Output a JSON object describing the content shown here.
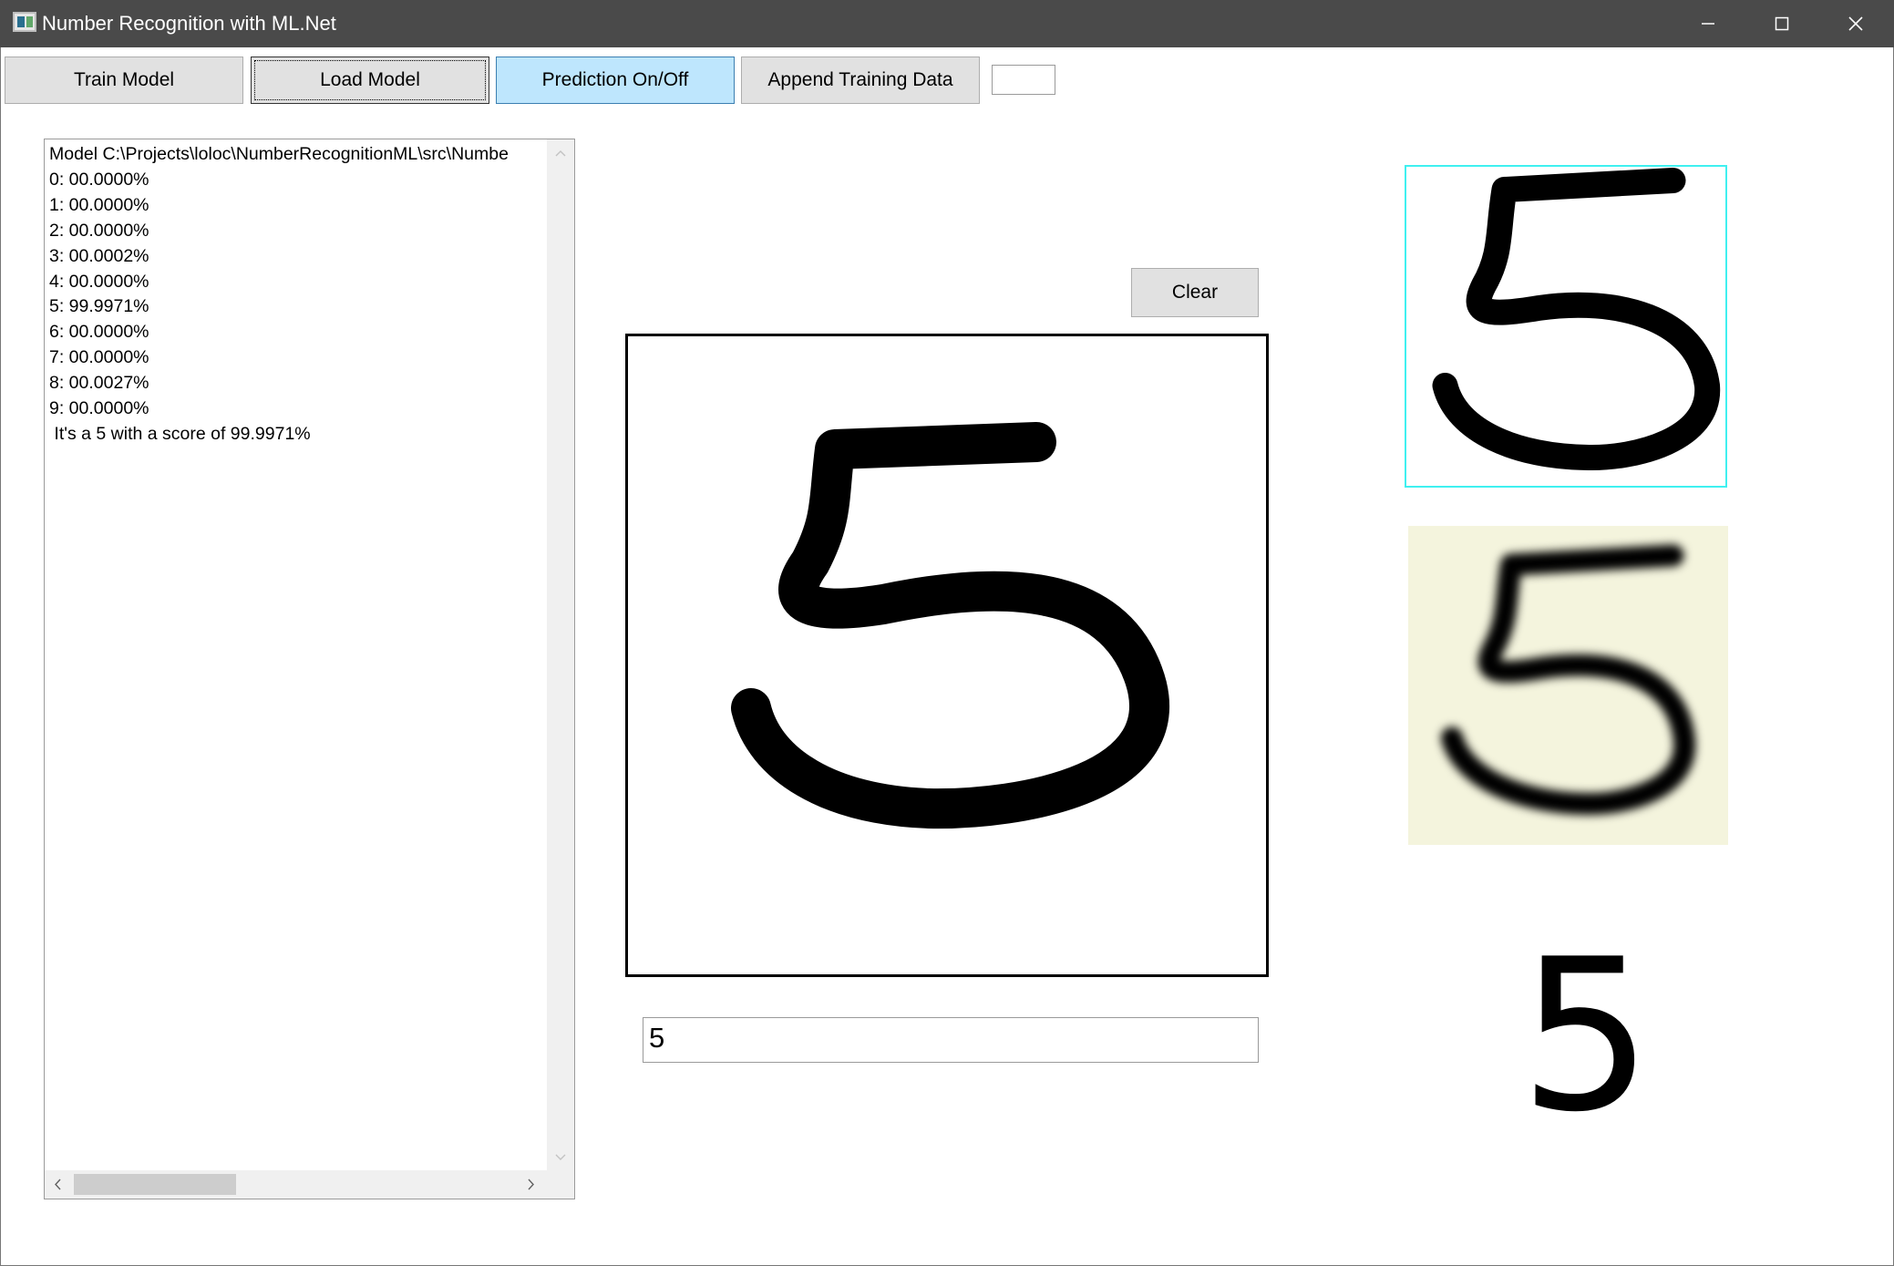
{
  "window": {
    "title": "Number Recognition with ML.Net"
  },
  "toolbar": {
    "train_label": "Train Model",
    "load_label": "Load Model",
    "prediction_label": "Prediction On/Off",
    "append_label": "Append Training Data",
    "small_field_value": ""
  },
  "log": {
    "lines": [
      "Model C:\\Projects\\loloc\\NumberRecognitionML\\src\\Numbe",
      "0: 00.0000%",
      "1: 00.0000%",
      "2: 00.0000%",
      "3: 00.0002%",
      "4: 00.0000%",
      "5: 99.9971%",
      "6: 00.0000%",
      "7: 00.0000%",
      "8: 00.0027%",
      "9: 00.0000%",
      " It's a 5 with a score of 99.9971%"
    ]
  },
  "canvas": {
    "clear_label": "Clear",
    "result_value": "5"
  },
  "preview": {
    "predicted_digit": "5"
  },
  "colors": {
    "titlebar": "#4a4a4a",
    "button_face": "#e1e1e1",
    "button_active": "#bee6fd",
    "button_active_border": "#3c7fb1",
    "crop_border": "#3ff0f0",
    "scaled_background": "#f4f4dd"
  },
  "icons": {
    "minimize": "minimize-icon",
    "maximize": "maximize-icon",
    "close": "close-icon",
    "scroll_up": "chevron-up-icon",
    "scroll_down": "chevron-down-icon",
    "scroll_left": "chevron-left-icon",
    "scroll_right": "chevron-right-icon"
  }
}
